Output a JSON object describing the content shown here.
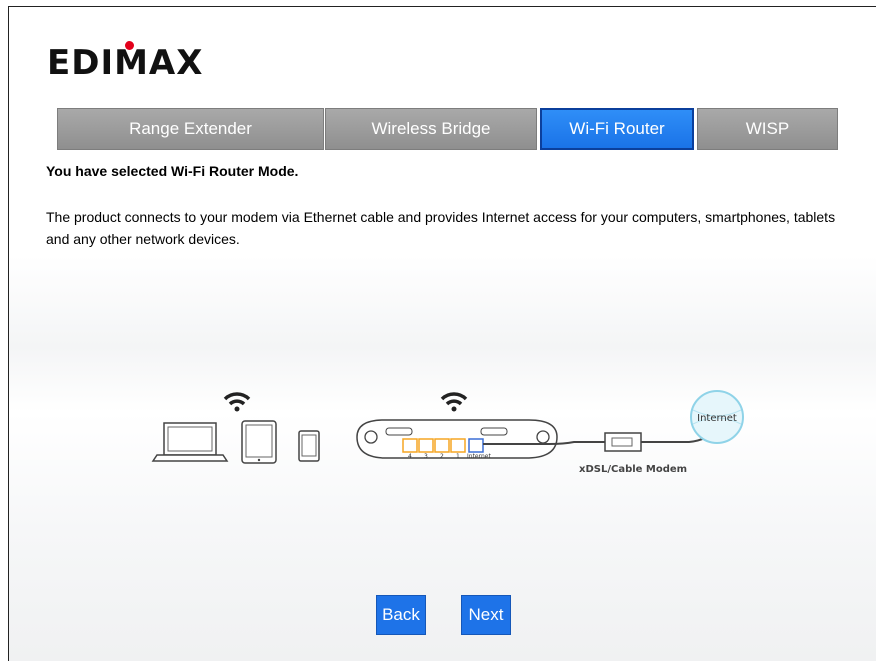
{
  "brand": {
    "logo_text": "EDIMAX",
    "accent_color": "#e3001b"
  },
  "tabs": [
    {
      "label": "Range Extender",
      "active": false
    },
    {
      "label": "Wireless Bridge",
      "active": false
    },
    {
      "label": "Wi-Fi Router",
      "active": true
    },
    {
      "label": "WISP",
      "active": false
    }
  ],
  "mode": {
    "selected_text": "You have selected Wi-Fi Router Mode.",
    "description": "The product connects to your modem via Ethernet cable and provides Internet access for your computers, smartphones, tablets and any other network devices."
  },
  "diagram": {
    "modem_label": "xDSL/Cable Modem",
    "internet_label": "Internet",
    "router_ports": [
      "4",
      "3",
      "2",
      "1",
      "Internet"
    ],
    "port_colors": {
      "lan": "#f5a623",
      "wan": "#3b6fd6"
    },
    "devices": [
      "laptop-icon",
      "tablet-icon",
      "smartphone-icon"
    ]
  },
  "actions": {
    "back_label": "Back",
    "next_label": "Next",
    "button_color": "#1e73e8"
  }
}
